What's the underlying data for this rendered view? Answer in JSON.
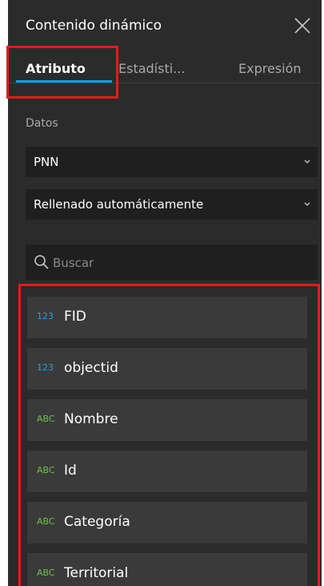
{
  "panel": {
    "title": "Contenido dinámico",
    "close_symbol": "✕"
  },
  "tabs": [
    {
      "label": "Atributo",
      "active": true
    },
    {
      "label": "Estadísti...",
      "active": false
    },
    {
      "label": "Expresión",
      "active": false
    }
  ],
  "data_section": {
    "label": "Datos",
    "source_select": "PNN",
    "mode_select": "Rellenado automáticamente"
  },
  "search": {
    "placeholder": "Buscar",
    "value": ""
  },
  "fields": [
    {
      "type_badge": "123",
      "type_icon": "number-type-icon",
      "name": "FID"
    },
    {
      "type_badge": "123",
      "type_icon": "number-type-icon",
      "name": "objectid"
    },
    {
      "type_badge": "ABC",
      "type_icon": "string-type-icon",
      "name": "Nombre"
    },
    {
      "type_badge": "ABC",
      "type_icon": "string-type-icon",
      "name": "Id"
    },
    {
      "type_badge": "ABC",
      "type_icon": "string-type-icon",
      "name": "Categoría"
    },
    {
      "type_badge": "ABC",
      "type_icon": "string-type-icon",
      "name": "Territorial"
    }
  ],
  "colors": {
    "panel_bg": "#2b2b2b",
    "input_bg": "#1f1f1f",
    "item_bg": "#3a3a3a",
    "number_badge": "#2a9fe0",
    "string_badge": "#6cc24a",
    "highlight_border": "#e31c1c",
    "active_tab_underline": "#00a0ff"
  }
}
